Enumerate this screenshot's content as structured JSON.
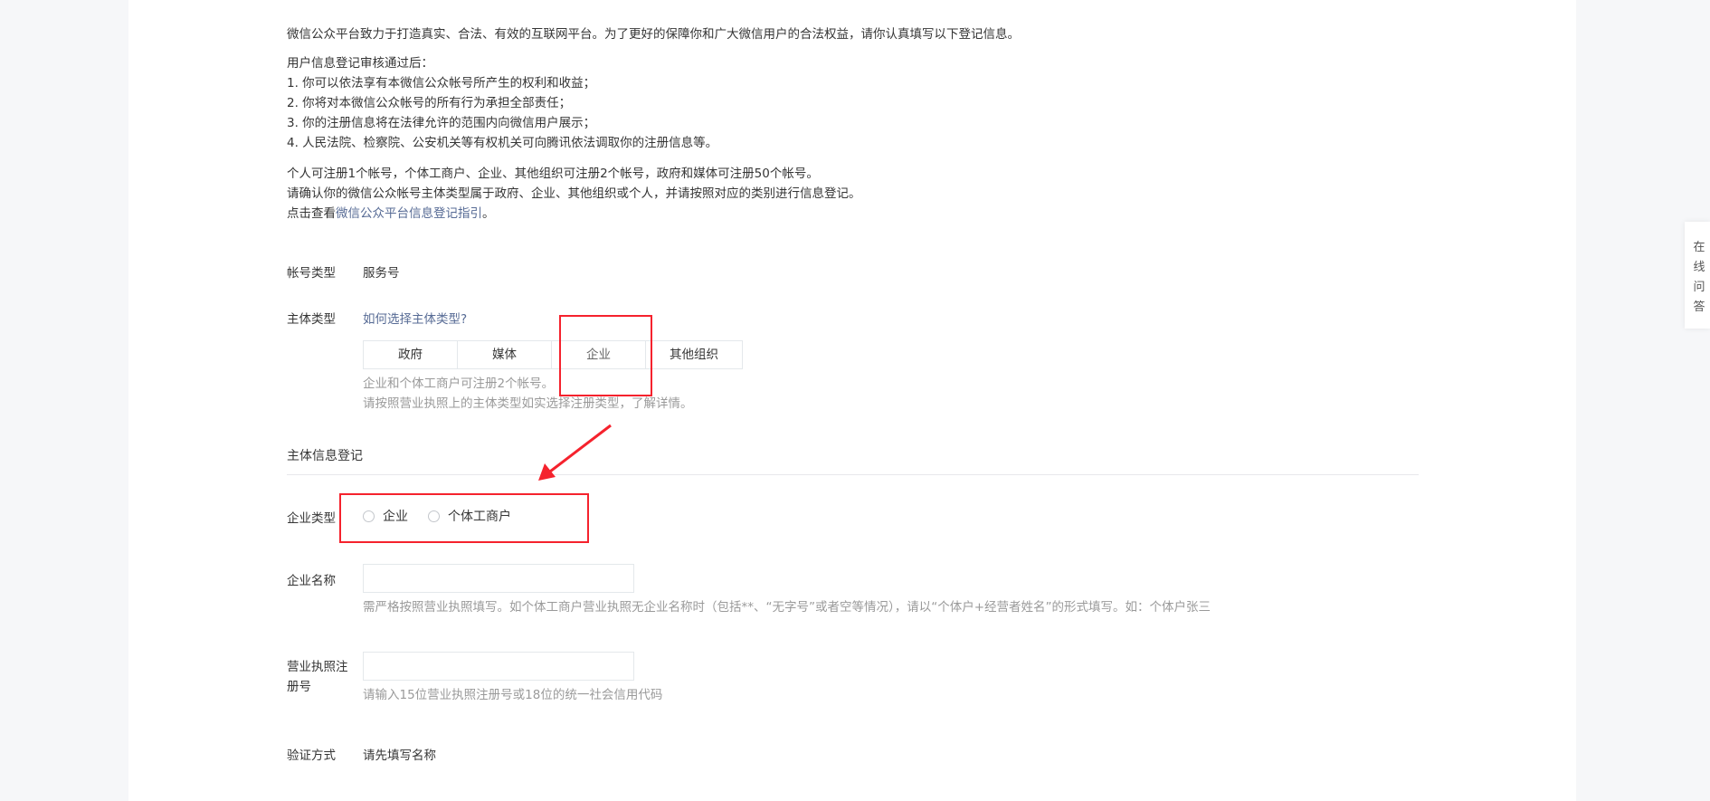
{
  "intro": {
    "line1": "微信公众平台致力于打造真实、合法、有效的互联网平台。为了更好的保障你和广大微信用户的合法权益，请你认真填写以下登记信息。",
    "review_heading": "用户信息登记审核通过后：",
    "review_items": [
      "1. 你可以依法享有本微信公众帐号所产生的权利和收益；",
      "2. 你将对本微信公众帐号的所有行为承担全部责任；",
      "3. 你的注册信息将在法律允许的范围内向微信用户展示；",
      "4. 人民法院、检察院、公安机关等有权机关可向腾讯依法调取你的注册信息等。"
    ],
    "limit_line": "个人可注册1个帐号，个体工商户、企业、其他组织可注册2个帐号，政府和媒体可注册50个帐号。",
    "confirm_line": "请确认你的微信公众帐号主体类型属于政府、企业、其他组织或个人，并请按照对应的类别进行信息登记。",
    "guide_prefix": "点击查看",
    "guide_link": "微信公众平台信息登记指引",
    "guide_suffix": "。"
  },
  "account_type": {
    "label": "帐号类型",
    "value": "服务号"
  },
  "subject_type": {
    "label": "主体类型",
    "help_link": "如何选择主体类型?",
    "options": [
      "政府",
      "媒体",
      "企业",
      "其他组织"
    ],
    "selected": "企业",
    "tip1": "企业和个体工商户可注册2个帐号。",
    "tip2": "请按照营业执照上的主体类型如实选择注册类型，了解详情。"
  },
  "section_title": "主体信息登记",
  "enterprise_type": {
    "label": "企业类型",
    "options": [
      "企业",
      "个体工商户"
    ]
  },
  "enterprise_name": {
    "label": "企业名称",
    "value": "",
    "tip": "需严格按照营业执照填写。如个体工商户营业执照无企业名称时（包括**、“无字号”或者空等情况），请以“个体户+经营者姓名”的形式填写。如：个体户张三"
  },
  "license_no": {
    "label_line1": "营业执照注",
    "label_line2": "册号",
    "value": "",
    "tip": "请输入15位营业执照注册号或18位的统一社会信用代码"
  },
  "verify": {
    "label": "验证方式",
    "value": "请先填写名称"
  },
  "side_float": {
    "chars": [
      "在",
      "线",
      "问",
      "答"
    ]
  },
  "colors": {
    "link": "#576b95",
    "annotation": "#f5222d",
    "background": "#f6f7f9"
  }
}
